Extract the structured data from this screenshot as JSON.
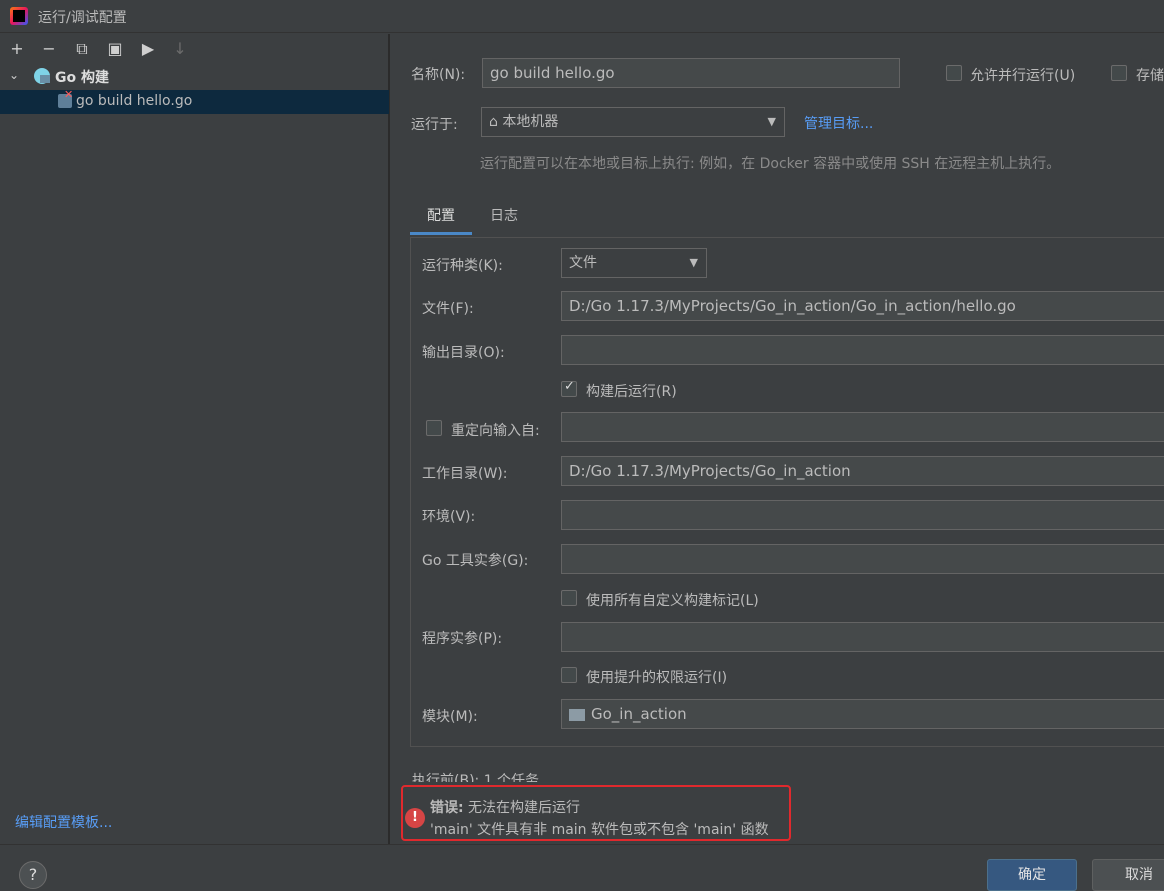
{
  "window": {
    "title": "运行/调试配置"
  },
  "toolbar": {
    "add": "+",
    "remove": "−",
    "copy": "⧉",
    "save": "▣",
    "folder": "▶",
    "sort": "↓"
  },
  "tree": {
    "group_label": "Go 构建",
    "selected_item": "go build hello.go"
  },
  "left_footer": {
    "edit_templates": "编辑配置模板..."
  },
  "header": {
    "name_label": "名称(N):",
    "name_value": "go build hello.go",
    "allow_parallel": "允许并行运行(U)",
    "store_label": "存储",
    "run_on_label": "运行于:",
    "run_on_value": "本地机器",
    "manage_targets": "管理目标...",
    "hint": "运行配置可以在本地或目标上执行: 例如，在 Docker 容器中或使用 SSH 在远程主机上执行。"
  },
  "tabs": [
    {
      "label": "配置",
      "active": true
    },
    {
      "label": "日志",
      "active": false
    }
  ],
  "form": {
    "run_kind_label": "运行种类(K):",
    "run_kind_value": "文件",
    "file_label": "文件(F):",
    "file_value": "D:/Go 1.17.3/MyProjects/Go_in_action/Go_in_action/hello.go",
    "output_dir_label": "输出目录(O):",
    "output_dir_value": "",
    "run_after_build_label": "构建后运行(R)",
    "run_after_build_checked": true,
    "redirect_input_label": "重定向输入自:",
    "redirect_input_checked": false,
    "redirect_input_value": "",
    "working_dir_label": "工作目录(W):",
    "working_dir_value": "D:/Go 1.17.3/MyProjects/Go_in_action",
    "env_label": "环境(V):",
    "env_value": "",
    "go_tool_args_label": "Go 工具实参(G):",
    "go_tool_args_value": "",
    "use_all_tags_label": "使用所有自定义构建标记(L)",
    "use_all_tags_checked": false,
    "program_args_label": "程序实参(P):",
    "program_args_value": "",
    "elevated_label": "使用提升的权限运行(I)",
    "elevated_checked": false,
    "module_label": "模块(M):",
    "module_value": "Go_in_action"
  },
  "before_launch": "执行前(B): 1 个任务",
  "error": {
    "title_bold": "错误:",
    "title_rest": " 无法在构建后运行",
    "detail": "'main' 文件具有非 main 软件包或不包含 'main' 函数"
  },
  "buttons": {
    "help": "?",
    "ok": "确定",
    "cancel": "取消"
  },
  "colors": {
    "accent": "#365880",
    "link": "#589df6",
    "error": "#e0292d",
    "selection": "#0d293e"
  }
}
